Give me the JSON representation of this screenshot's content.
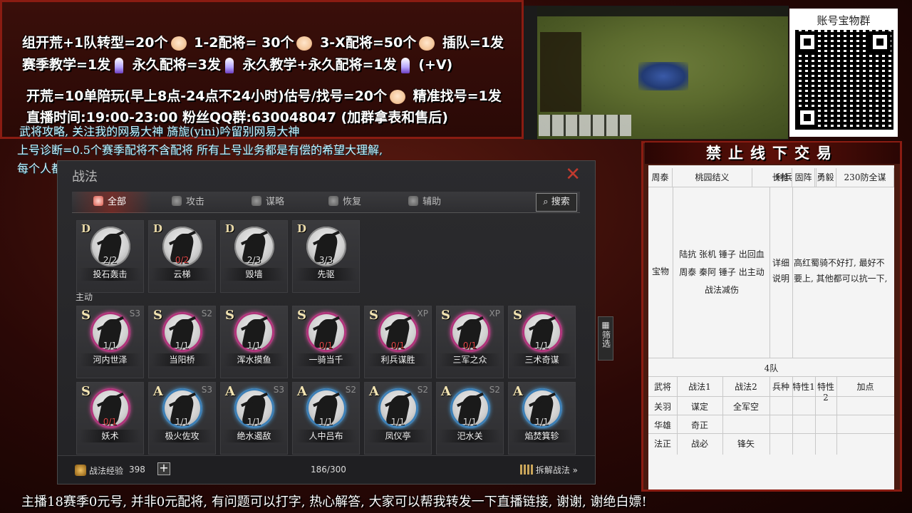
{
  "overlay": {
    "line1": "组开荒+1队转型=20个",
    "line1b": "1-2配将= 30个",
    "line1c": "3-X配将=50个",
    "line1d": "插队=1发",
    "line2a": "赛季教学=1发",
    "line2b": "永久配将=3发",
    "line2c": "永久教学+永久配将=1发",
    "line2d": "(+V)",
    "line3a": "开荒=10单陪玩(早上8点-24点不24小时)估号/找号=20个",
    "line3b": "精准找号=1发",
    "line4": "直播时间:19:00-23:00  粉丝QQ群:630048047 (加群拿表和售后)",
    "line5": "武将攻略, 关注我的网易大神 旖旎(yini)吟留别网易大神",
    "line6": "上号诊断=0.5个赛季配将不含配将 所有上号业务都是有偿的希望大理解,",
    "line7": "每个人都要上一碗水端不平 礼物现在收双刃斧谢谢"
  },
  "qr": {
    "title": "账号宝物群"
  },
  "panel": {
    "title": "战法",
    "tabs": [
      "全部",
      "攻击",
      "谋略",
      "恢复",
      "辅助"
    ],
    "search": "搜索",
    "section_main": "主动",
    "filter": "筛选",
    "exp_label": "战法经验",
    "exp_value": "398",
    "add": "+",
    "count": "186/300",
    "dismantle": "拆解战法 »"
  },
  "cards_top": [
    {
      "grade": "D",
      "count": "2/2",
      "name": "投石轰击",
      "zero": false
    },
    {
      "grade": "D",
      "count": "0/2",
      "name": "云梯",
      "zero": true
    },
    {
      "grade": "D",
      "count": "2/3",
      "name": "毁墙",
      "zero": false
    },
    {
      "grade": "D",
      "count": "3/3",
      "name": "先驱",
      "zero": false
    }
  ],
  "cards_row1": [
    {
      "grade": "S",
      "season": "S3",
      "count": "1/1",
      "name": "河内世泽",
      "zero": false
    },
    {
      "grade": "S",
      "season": "S2",
      "count": "1/1",
      "name": "当阳桥",
      "zero": false
    },
    {
      "grade": "S",
      "season": "",
      "count": "1/1",
      "name": "浑水摸鱼",
      "zero": false
    },
    {
      "grade": "S",
      "season": "",
      "count": "0/1",
      "name": "一骑当千",
      "zero": true
    },
    {
      "grade": "S",
      "season": "XP",
      "count": "0/1",
      "name": "利兵谋胜",
      "zero": true
    },
    {
      "grade": "S",
      "season": "XP",
      "count": "0/1",
      "name": "三军之众",
      "zero": true
    },
    {
      "grade": "S",
      "season": "",
      "count": "1/1",
      "name": "三术奇谋",
      "zero": false
    }
  ],
  "cards_row2": [
    {
      "grade": "S",
      "season": "",
      "count": "0/1",
      "name": "妖术",
      "zero": true
    },
    {
      "grade": "A",
      "season": "S3",
      "count": "1/1",
      "name": "极火佐攻",
      "zero": false
    },
    {
      "grade": "A",
      "season": "S3",
      "count": "1/1",
      "name": "绝水遏敌",
      "zero": false
    },
    {
      "grade": "A",
      "season": "S2",
      "count": "1/1",
      "name": "人中吕布",
      "zero": false
    },
    {
      "grade": "A",
      "season": "S2",
      "count": "1/1",
      "name": "凤仪亭",
      "zero": false
    },
    {
      "grade": "A",
      "season": "S2",
      "count": "1/1",
      "name": "汜水关",
      "zero": false
    },
    {
      "grade": "A",
      "season": "",
      "count": "1/1",
      "name": "焰焚箕轸",
      "zero": false
    }
  ],
  "banner": "禁止线下交易",
  "sheet": {
    "headers": [
      "周泰",
      "桃园结义",
      "利兵",
      "长枪",
      "固阵",
      "勇毅",
      "230防全谋"
    ],
    "row_label": "宝物",
    "note_a": "陆抗 张机 锤子 出回血",
    "note_b": "周泰 秦阿 锤子 出主动",
    "note_c": "战法减伤",
    "detail": "详细说明",
    "comment": "高红蜀骑不好打, 最好不要上, 其他都可以抗一下,",
    "team": "4队",
    "cols": [
      "武将",
      "战法1",
      "战法2",
      "兵种",
      "特性1",
      "特性2",
      "加点"
    ],
    "rows": [
      {
        "general": "关羽",
        "s1": "谋定",
        "s2": "全军空"
      },
      {
        "general": "华雄",
        "s1": "奇正",
        "s2": ""
      },
      {
        "general": "法正",
        "s1": "战必",
        "s2": "锋矢"
      }
    ]
  },
  "footer": "主播18赛季0元号, 并非0元配将, 有问题可以打字, 热心解答, 大家可以帮我转发一下直播链接, 谢谢, 谢绝白嫖!"
}
